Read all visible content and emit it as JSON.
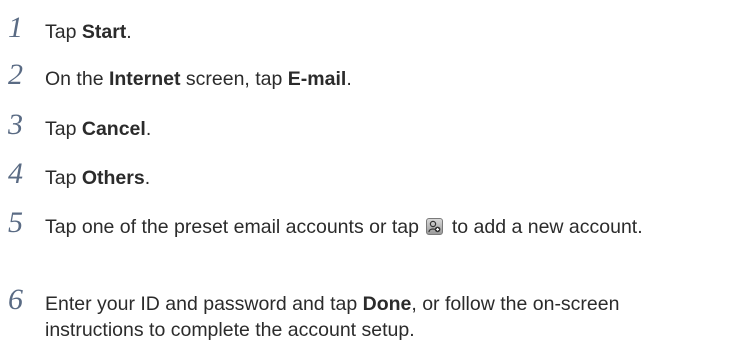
{
  "steps": [
    {
      "number": "1",
      "parts": [
        "Tap ",
        "Start",
        "."
      ]
    },
    {
      "number": "2",
      "parts": [
        "On the ",
        "Internet",
        " screen, tap ",
        "E-mail",
        "."
      ]
    },
    {
      "number": "3",
      "parts": [
        "Tap ",
        "Cancel",
        "."
      ]
    },
    {
      "number": "4",
      "parts": [
        "Tap ",
        "Others",
        "."
      ]
    },
    {
      "number": "5",
      "before_icon": "Tap one of the preset email accounts or tap ",
      "icon": "add-account-icon",
      "after_icon": " to add a new account."
    },
    {
      "number": "6",
      "parts": [
        "Enter your ID and password and tap ",
        "Done",
        ", or follow the on-screen instructions to complete the account setup."
      ]
    }
  ]
}
